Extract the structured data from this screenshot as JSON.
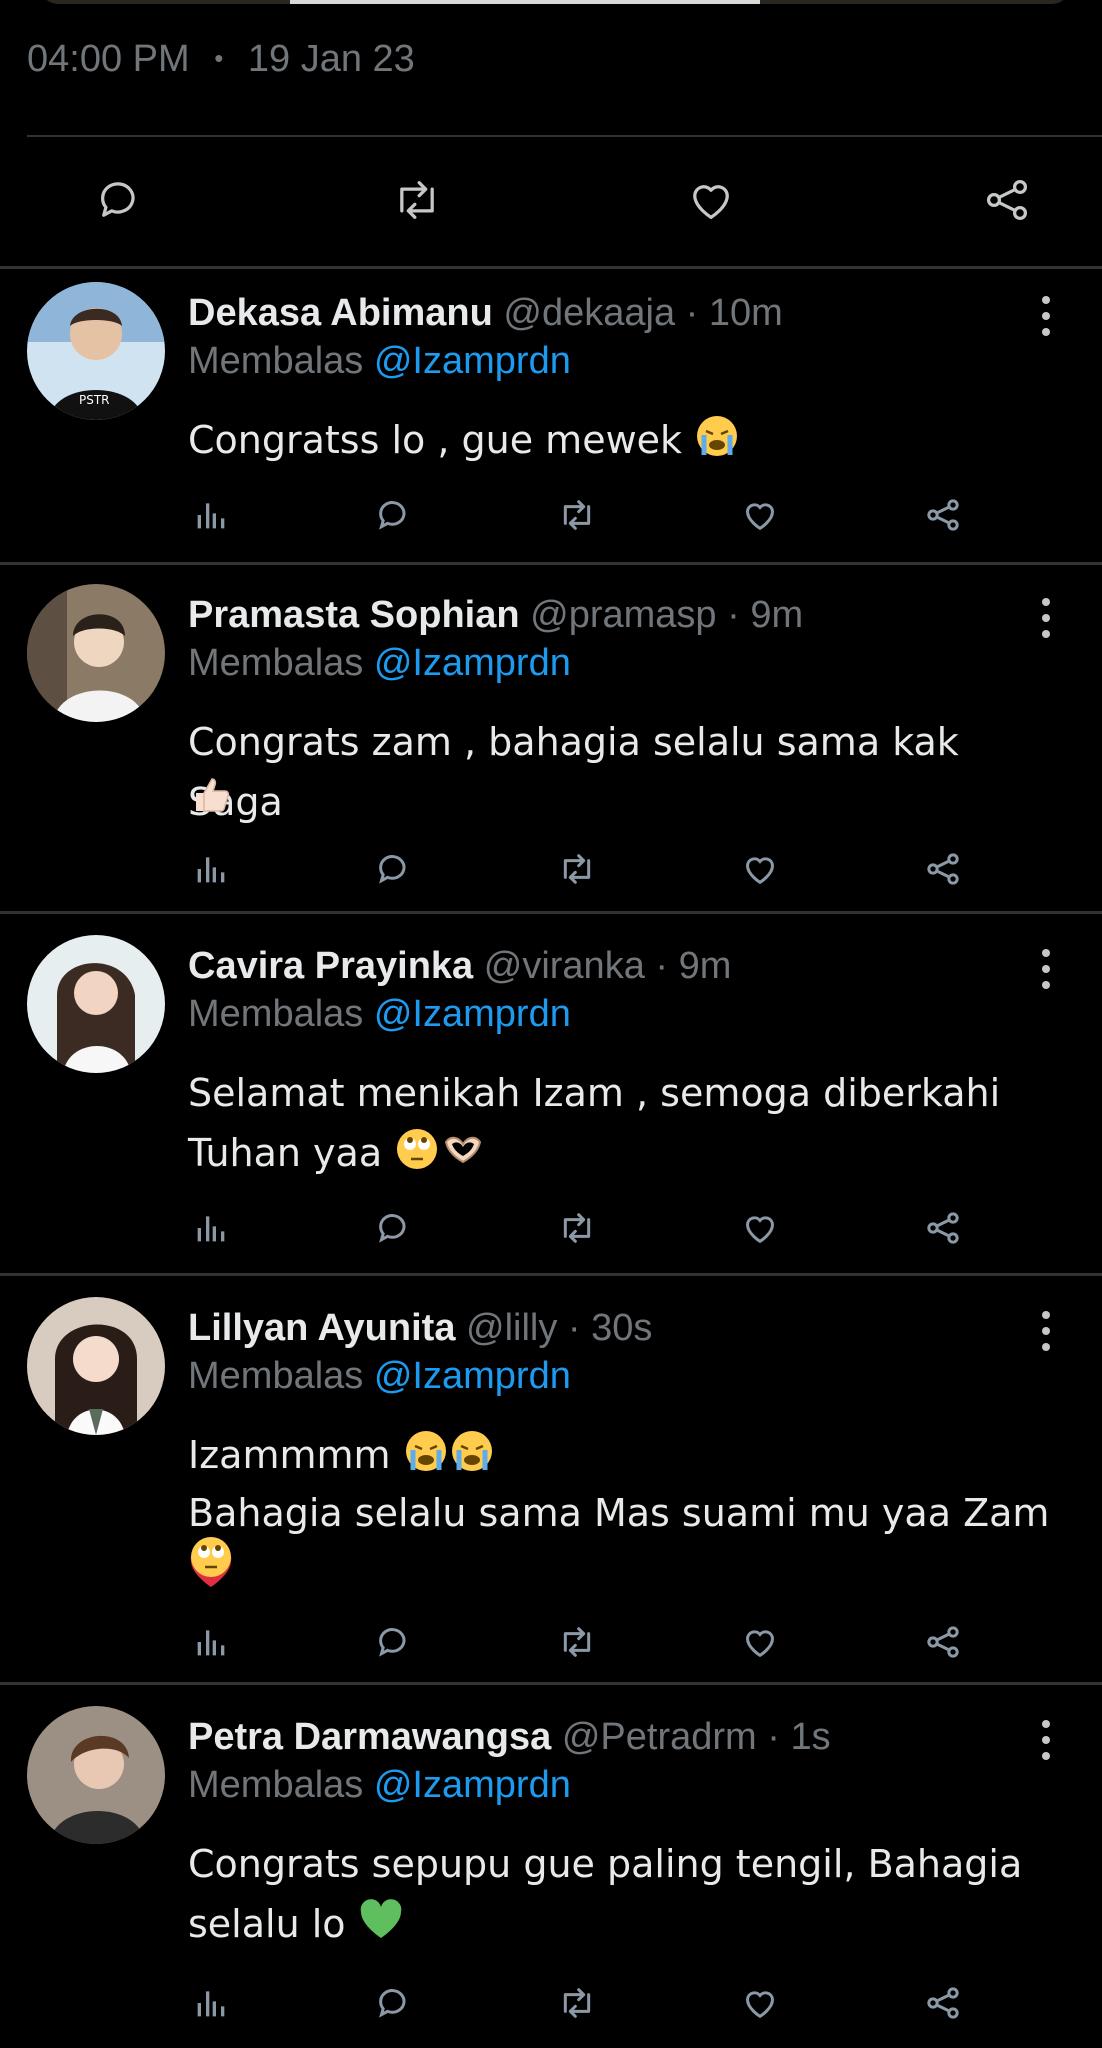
{
  "tweet": {
    "time": "04:00 PM",
    "dot": "•",
    "date": "19 Jan 23"
  },
  "replying_prefix": "Membalas",
  "reply_handle": "@Izamprdn",
  "colors": {
    "bg": "#000000",
    "muted": "#71767b",
    "accent": "#1d9bf0",
    "divider": "#2f3336"
  },
  "replies": [
    {
      "name": "Dekasa Abimanu",
      "handle": "@dekaaja",
      "time": "10m",
      "line1": "Congratss lo , gue mewek",
      "line2": "",
      "line3": "",
      "emojis": [
        "loudly-crying-face"
      ]
    },
    {
      "name": "Pramasta Sophian",
      "handle": "@pramasp",
      "time": "9m",
      "line1": "Congrats zam , bahagia selalu sama kak Saga",
      "line2": "",
      "line3": "",
      "emojis": [
        "thumbs-up"
      ]
    },
    {
      "name": "Cavira Prayinka",
      "handle": "@viranka",
      "time": "9m",
      "line1": "Selamat menikah Izam , semoga diberkahi",
      "line2": "Tuhan yaa",
      "line3": "",
      "emojis": [
        "face-with-rolling-eyes",
        "heart-hands"
      ]
    },
    {
      "name": "Lillyan Ayunita",
      "handle": "@lilly",
      "time": "30s",
      "line1": "Izammmm",
      "line2": "Bahagia selalu sama Mas suami mu yaa Zam",
      "line3": "",
      "emojis": [
        "loudly-crying-face",
        "loudly-crying-face",
        "red-heart",
        "face-with-rolling-eyes"
      ]
    },
    {
      "name": "Petra Darmawangsa",
      "handle": "@Petradrm",
      "time": "1s",
      "line1": "Congrats sepupu gue paling tengil, Bahagia",
      "line2": "selalu lo",
      "line3": "",
      "emojis": [
        "green-heart"
      ]
    }
  ]
}
